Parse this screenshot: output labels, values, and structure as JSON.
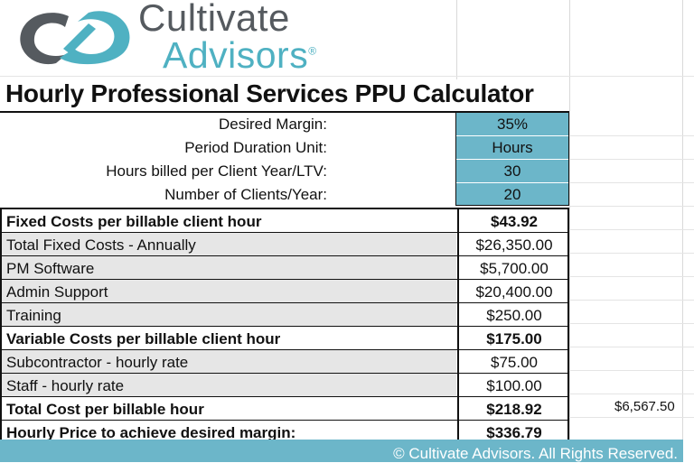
{
  "brand": {
    "line1": "Cultivate",
    "line2": "Advisors",
    "reg": "®",
    "primary_color": "#4fb1c2",
    "text_color": "#555a5f"
  },
  "title": "Hourly Professional Services PPU Calculator",
  "inputs": [
    {
      "label": "Desired Margin:",
      "value": "35%"
    },
    {
      "label": "Period Duration Unit:",
      "value": "Hours"
    },
    {
      "label": "Hours billed per Client Year/LTV:",
      "value": "30"
    },
    {
      "label": "Number of Clients/Year:",
      "value": "20"
    }
  ],
  "input_color": "#6cb6c9",
  "costs": [
    {
      "label": "Fixed Costs per billable client hour",
      "value": "$43.92",
      "bold": true
    },
    {
      "label": "Total Fixed Costs - Annually",
      "value": "$26,350.00"
    },
    {
      "label": "PM Software",
      "value": "$5,700.00"
    },
    {
      "label": "Admin Support",
      "value": "$20,400.00"
    },
    {
      "label": "Training",
      "value": "$250.00"
    },
    {
      "label": "Variable Costs per billable client hour",
      "value": "$175.00",
      "bold": true
    },
    {
      "label": "Subcontractor - hourly rate",
      "value": "$75.00"
    },
    {
      "label": "Staff - hourly rate",
      "value": "$100.00"
    },
    {
      "label": "Total Cost per billable hour",
      "value": "$218.92",
      "bold": true
    },
    {
      "label": "Hourly Price to achieve desired margin:",
      "value": "$336.79",
      "bold": true
    }
  ],
  "side_value": "$6,567.50",
  "footer": "© Cultivate Advisors. All Rights Reserved."
}
